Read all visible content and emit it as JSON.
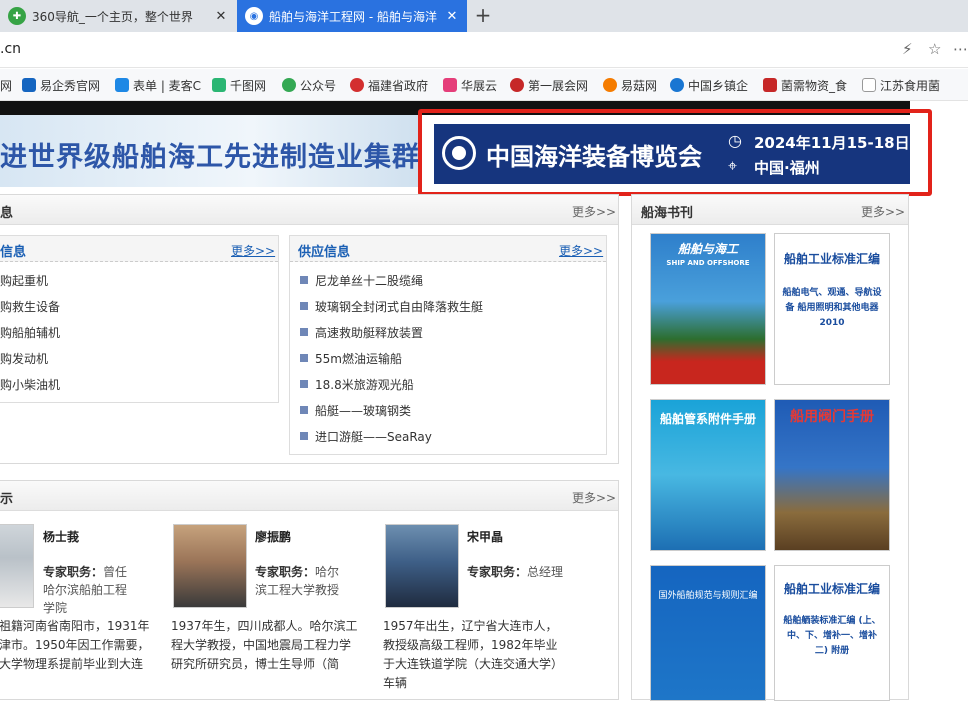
{
  "browser": {
    "tabs": [
      {
        "label": "360导航_一个主页，整个世界"
      },
      {
        "label": "船舶与海洋工程网 - 船舶与海洋"
      }
    ],
    "address": ".cn",
    "bookmarks": [
      {
        "label": "网"
      },
      {
        "label": "易企秀官网"
      },
      {
        "label": "表单 | 麦客C"
      },
      {
        "label": "千图网"
      },
      {
        "label": "公众号"
      },
      {
        "label": "福建省政府"
      },
      {
        "label": "华展云"
      },
      {
        "label": "第一展会网"
      },
      {
        "label": "易菇网"
      },
      {
        "label": "中国乡镇企"
      },
      {
        "label": "菌需物资_食"
      },
      {
        "label": "江苏食用菌"
      }
    ]
  },
  "banner": {
    "slogan": "进世界级船舶海工先进制造业集群",
    "expo_title": "中国海洋装备博览会",
    "expo_date": "2024年11月15-18日",
    "expo_place": "中国·福州"
  },
  "info_panel": {
    "title": "息",
    "more": "更多>>",
    "demand": {
      "title": "信息",
      "more": "更多>>",
      "items": [
        "购起重机",
        "购救生设备",
        "购船舶辅机",
        "购发动机",
        "购小柴油机"
      ]
    },
    "supply": {
      "title": "供应信息",
      "more": "更多>>",
      "items": [
        "尼龙单丝十二股缆绳",
        "玻璃钢全封闭式自由降落救生艇",
        "高速救助艇释放装置",
        "55m燃油运输船",
        "18.8米旅游观光船",
        "船艇——玻璃钢类",
        "进口游艇——SeaRay"
      ]
    }
  },
  "experts_panel": {
    "title": "示",
    "more": "更多>>",
    "role_label": "专家职务：",
    "experts": [
      {
        "name": "杨士莪",
        "role": "曾任哈尔滨船舶工程学院",
        "bio": "祖籍河南省南阳市，1931年津市。1950年因工作需要，大学物理系提前毕业到大连"
      },
      {
        "name": "廖振鹏",
        "role": "哈尔滨工程大学教授",
        "bio": "1937年生，四川成都人。哈尔滨工程大学教授，中国地震局工程力学研究所研究员，博士生导师（简"
      },
      {
        "name": "宋甲晶",
        "role": "总经理",
        "bio": "1957年出生，辽宁省大连市人，教授级高级工程师，1982年毕业于大连铁道学院（大连交通大学）车辆"
      }
    ]
  },
  "books_panel": {
    "title": "船海书刊",
    "more": "更多>>",
    "books": [
      {
        "title": "船舶与海工",
        "sub": "SHIP AND OFFSHORE"
      },
      {
        "title": "船舶工业标准汇编",
        "sub": "船舶电气、观通、导航设备 船用照明和其他电器 2010"
      },
      {
        "title": "船舶管系附件手册",
        "sub": ""
      },
      {
        "title": "船用阀门手册",
        "sub": ""
      },
      {
        "title": "国外船舶规范与规则汇编",
        "sub": ""
      },
      {
        "title": "船舶工业标准汇编",
        "sub": "船舶舾装标准汇编 (上、中、下、增补一、增补二) 附册"
      }
    ]
  },
  "colors": {
    "tab_active": "#2a72e0",
    "expo_bg": "#16357e",
    "highlight_border": "#e2231a",
    "link": "#1a5fb4"
  }
}
